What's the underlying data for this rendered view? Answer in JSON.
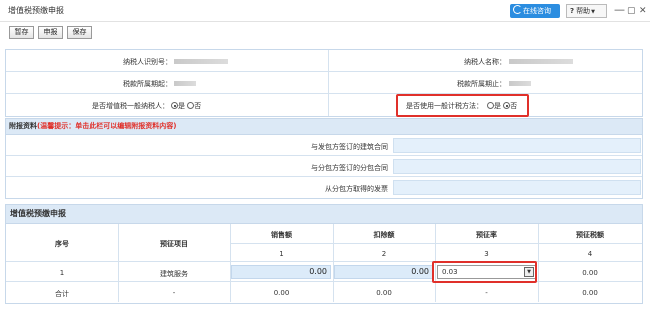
{
  "window": {
    "title": "增值税预缴申报",
    "online_label": "在线咨询",
    "help_label": "帮助",
    "help_q": "?",
    "help_caret": "▼",
    "minimize": "—",
    "maximize": "▢",
    "close": "✕"
  },
  "toolbar": {
    "save_temp": "暂存",
    "declare": "申报",
    "save": "保存"
  },
  "taxpayer": {
    "id_label": "纳税人识别号：",
    "name_label": "纳税人名称：",
    "start_label": "税款所属期起：",
    "end_label": "税款所属期止：",
    "general_label": "是否增值税一般纳税人：",
    "general_yes": "是",
    "general_no": "否",
    "simple_label": "是否使用一般计税方法：",
    "simple_yes": "是",
    "simple_no": "否"
  },
  "attachment": {
    "title": "附报资料",
    "tip": "(温馨提示：单击此栏可以编辑附报资料内容)",
    "rows": [
      "与发包方签订的建筑合同",
      "与分包方签订的分包合同",
      "从分包方取得的发票"
    ]
  },
  "prepay": {
    "title": "增值税预缴申报",
    "headers": {
      "seq": "序号",
      "item": "预征项目",
      "sales": "销售额",
      "deduct": "扣除额",
      "rate": "预征率",
      "tax": "预征税额"
    },
    "col_nums": [
      "1",
      "2",
      "3",
      "4"
    ],
    "row1": {
      "seq": "1",
      "item": "建筑服务",
      "sales": "0.00",
      "deduct": "0.00",
      "rate": "0.03",
      "tax": "0.00"
    },
    "total": {
      "seq": "合计",
      "item": "-",
      "sales": "0.00",
      "deduct": "0.00",
      "rate": "-",
      "tax": "0.00"
    },
    "select_arrow": "▼"
  },
  "colors": {
    "accent_blue": "#2b8de0",
    "highlight_red": "#e0302a",
    "tip_red": "#e0302a",
    "input_bg": "#dcebf9",
    "section_bg": "#dce9f6"
  }
}
